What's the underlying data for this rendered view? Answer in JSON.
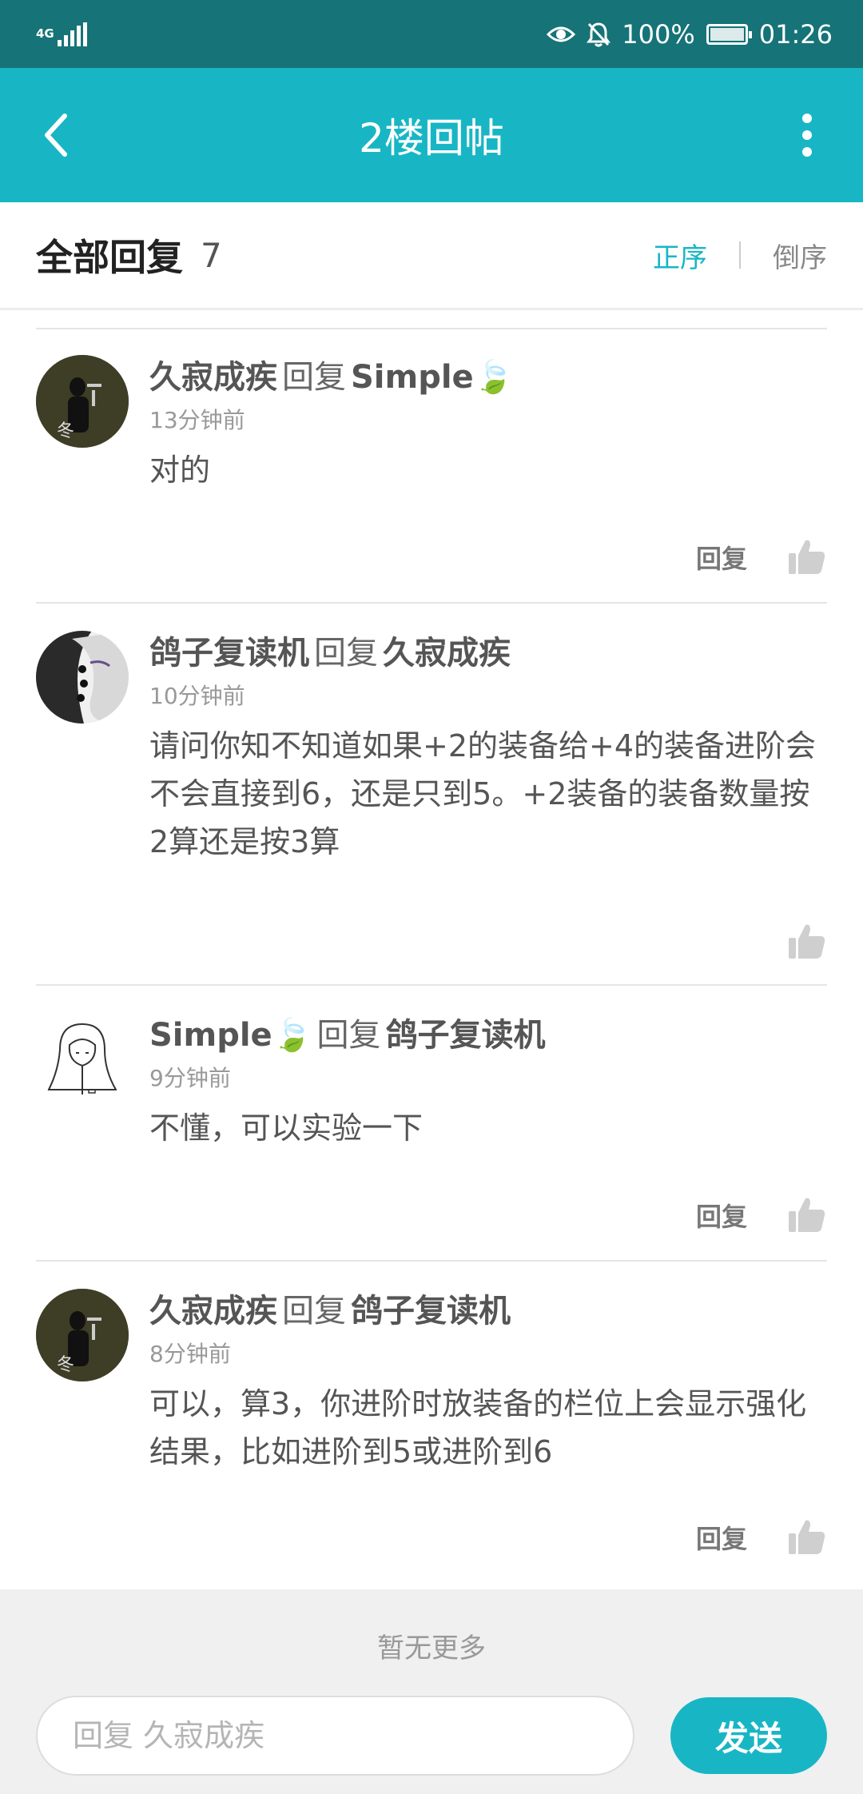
{
  "status_bar": {
    "network": "4G",
    "battery": "100%",
    "time": "01:26",
    "icons": [
      "signal-icon",
      "eye-icon",
      "mute-bell-icon",
      "battery-icon"
    ]
  },
  "header": {
    "title": "2楼回帖",
    "back_icon": "chevron-left-icon",
    "more_icon": "more-vertical-icon"
  },
  "sort_bar": {
    "label": "全部回复",
    "count": "7",
    "asc": "正序",
    "desc": "倒序",
    "active": "正序",
    "accent_color": "#18b6c5"
  },
  "comments": [
    {
      "author": "久寂成疾",
      "reply_word": "回复",
      "target": "Simple🍃",
      "time": "13分钟前",
      "content": "对的",
      "reply_label": "回复"
    },
    {
      "author": "鸽子复读机",
      "reply_word": "回复",
      "target": "久寂成疾",
      "time": "10分钟前",
      "content": "请问你知不知道如果+2的装备给+4的装备进阶会不会直接到6，还是只到5。+2装备的装备数量按2算还是按3算",
      "reply_label": ""
    },
    {
      "author": "Simple🍃",
      "reply_word": "回复",
      "target": "鸽子复读机",
      "time": "9分钟前",
      "content": "不懂，可以实验一下",
      "reply_label": "回复"
    },
    {
      "author": "久寂成疾",
      "reply_word": "回复",
      "target": "鸽子复读机",
      "time": "8分钟前",
      "content": "可以，算3，你进阶时放装备的栏位上会显示强化结果，比如进阶到5或进阶到6",
      "reply_label": "回复"
    }
  ],
  "footer": {
    "no_more": "暂无更多",
    "input_placeholder": "回复 久寂成疾",
    "send_label": "发送"
  }
}
